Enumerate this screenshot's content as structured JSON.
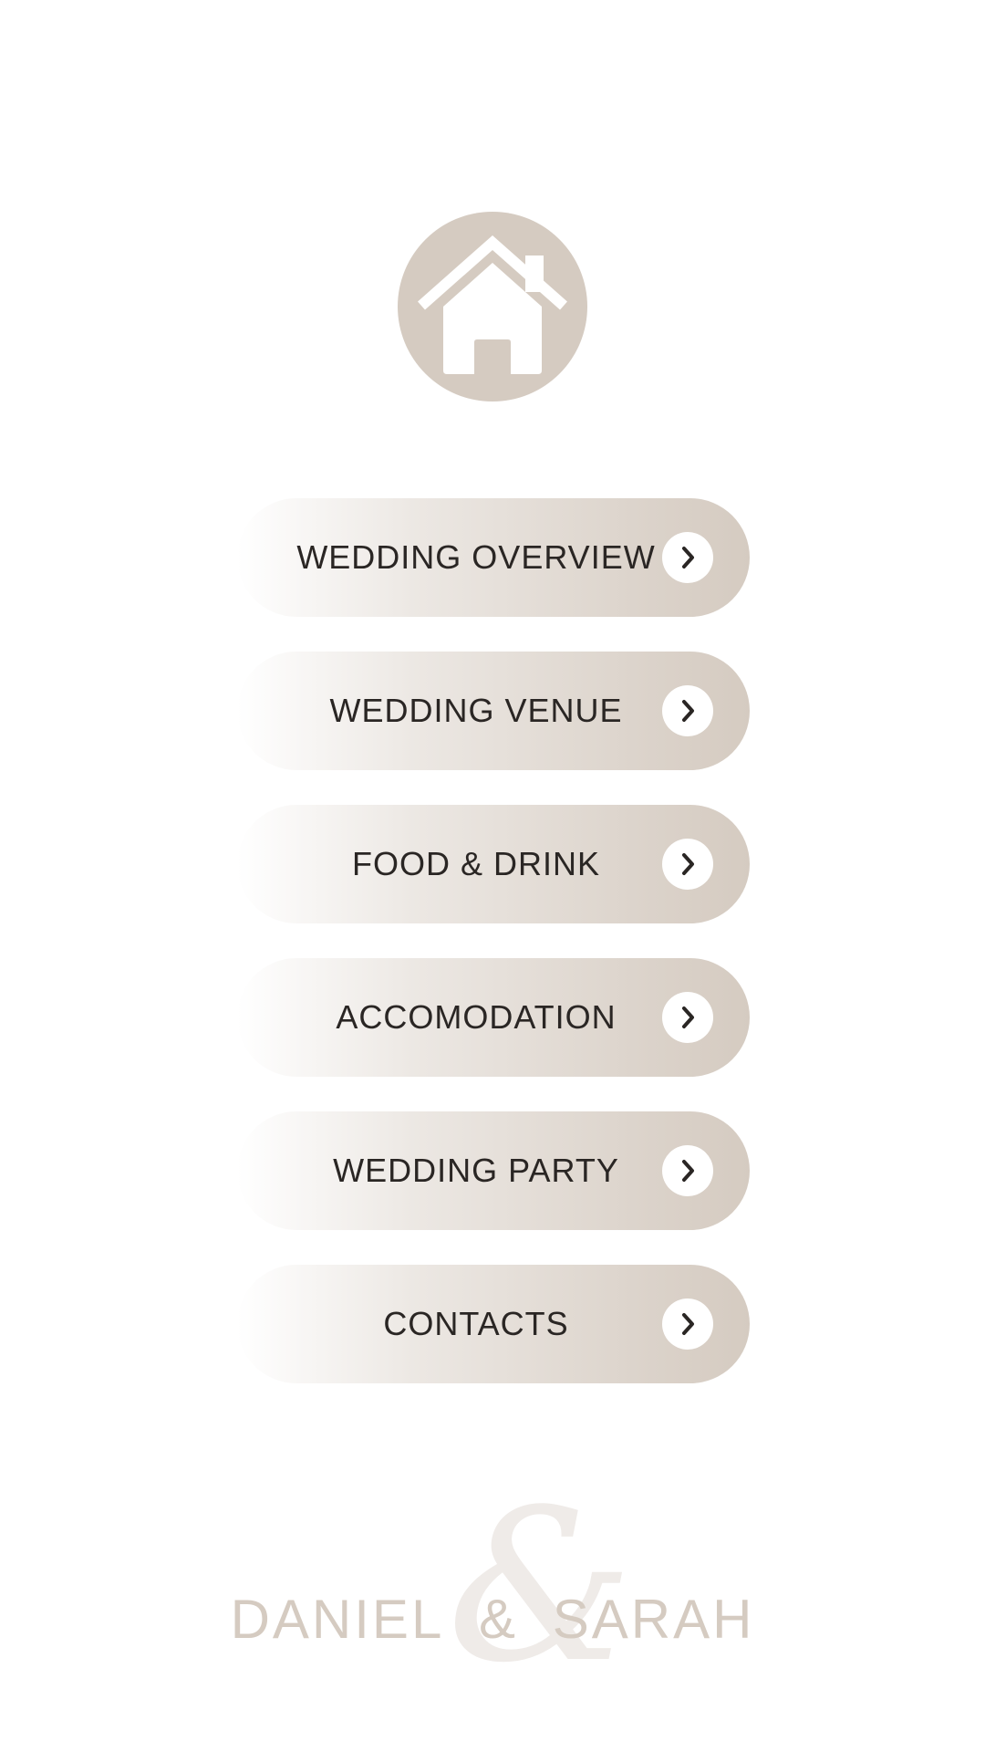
{
  "header": {
    "icon": "home-icon",
    "accent_color": "#d5cbc1"
  },
  "menu": {
    "items": [
      {
        "label": "WEDDING OVERVIEW",
        "icon": "chevron-right-icon"
      },
      {
        "label": "WEDDING VENUE",
        "icon": "chevron-right-icon"
      },
      {
        "label": "FOOD & DRINK",
        "icon": "chevron-right-icon"
      },
      {
        "label": "ACCOMODATION",
        "icon": "chevron-right-icon"
      },
      {
        "label": "WEDDING PARTY",
        "icon": "chevron-right-icon"
      },
      {
        "label": "CONTACTS",
        "icon": "chevron-right-icon"
      }
    ]
  },
  "footer": {
    "name_left": "DANIEL",
    "ampersand": "&",
    "name_right": "SARAH",
    "script_ampersand": "&"
  }
}
